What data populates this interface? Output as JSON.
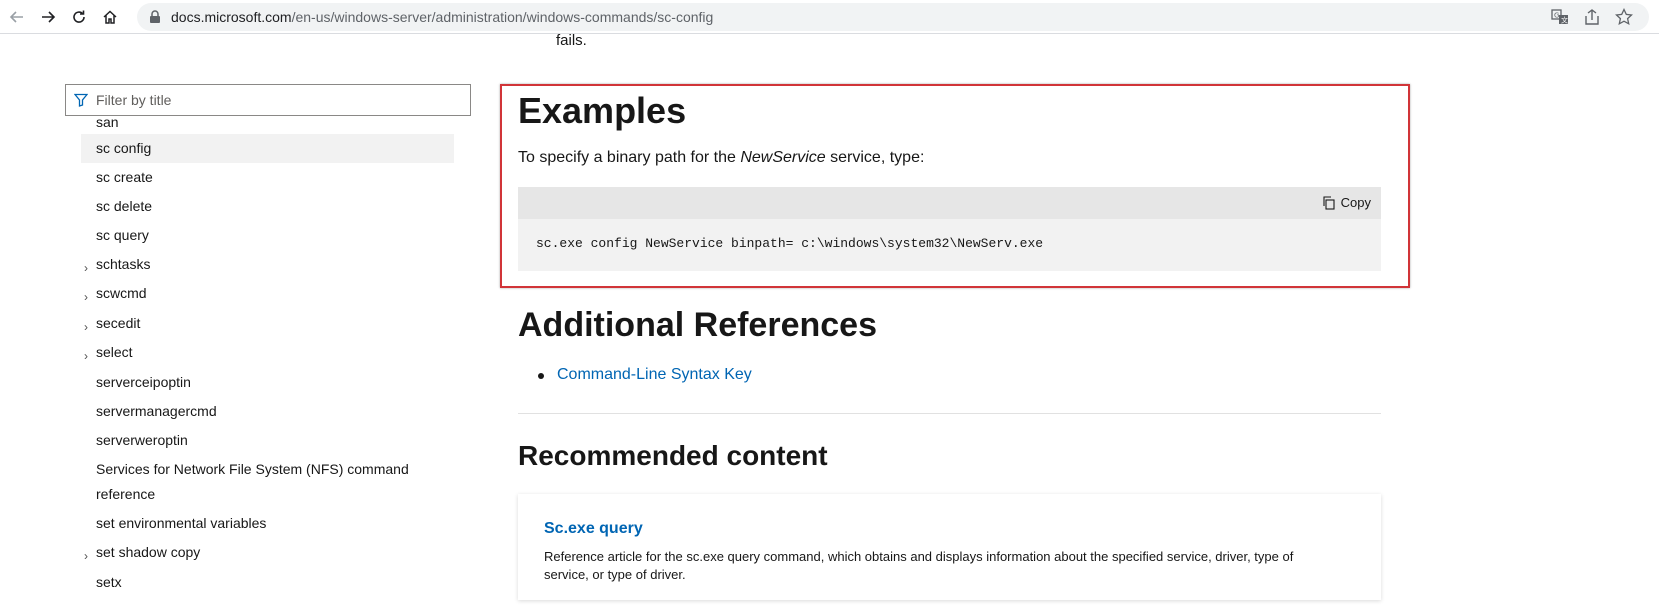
{
  "browser": {
    "url_host": "docs.microsoft.com",
    "url_path": "/en-us/windows-server/administration/windows-commands/sc-config",
    "icons": [
      "back-icon",
      "forward-icon",
      "reload-icon",
      "home-icon",
      "lock-icon",
      "translate-icon",
      "share-icon",
      "bookmark-star-icon"
    ]
  },
  "content_top_fragment": "fails.",
  "sidebar": {
    "filter_placeholder": "Filter by title",
    "items": [
      {
        "label": "san",
        "expandable": false,
        "active": false
      },
      {
        "label": "sc config",
        "expandable": false,
        "active": true
      },
      {
        "label": "sc create",
        "expandable": false,
        "active": false
      },
      {
        "label": "sc delete",
        "expandable": false,
        "active": false
      },
      {
        "label": "sc query",
        "expandable": false,
        "active": false
      },
      {
        "label": "schtasks",
        "expandable": true,
        "active": false
      },
      {
        "label": "scwcmd",
        "expandable": true,
        "active": false
      },
      {
        "label": "secedit",
        "expandable": true,
        "active": false
      },
      {
        "label": "select",
        "expandable": true,
        "active": false
      },
      {
        "label": "serverceipoptin",
        "expandable": false,
        "active": false
      },
      {
        "label": "servermanagercmd",
        "expandable": false,
        "active": false
      },
      {
        "label": "serverweroptin",
        "expandable": false,
        "active": false
      },
      {
        "label": "Services for Network File System (NFS) command",
        "expandable": false,
        "active": false
      },
      {
        "label": "reference",
        "expandable": false,
        "active": false
      },
      {
        "label": "set environmental variables",
        "expandable": false,
        "active": false
      },
      {
        "label": "set shadow copy",
        "expandable": true,
        "active": false
      },
      {
        "label": "setx",
        "expandable": false,
        "active": false
      }
    ]
  },
  "examples": {
    "heading": "Examples",
    "intro_before": "To specify a binary path for the ",
    "intro_em": "NewService",
    "intro_after": " service, type:",
    "copy_label": "Copy",
    "code": "sc.exe config NewService binpath= c:\\windows\\system32\\NewServ.exe"
  },
  "additional_references": {
    "heading": "Additional References",
    "links": [
      "Command-Line Syntax Key"
    ]
  },
  "recommended": {
    "heading": "Recommended content",
    "card_title": "Sc.exe query",
    "card_desc_line1": "Reference article for the sc.exe query command, which obtains and displays information about the specified service, driver, type of",
    "card_desc_line2": "service, or type of driver."
  },
  "colors": {
    "link": "#0065b3",
    "highlight_border": "#d13438",
    "code_bg": "#f2f2f2",
    "code_header_bg": "#e6e6e6"
  }
}
